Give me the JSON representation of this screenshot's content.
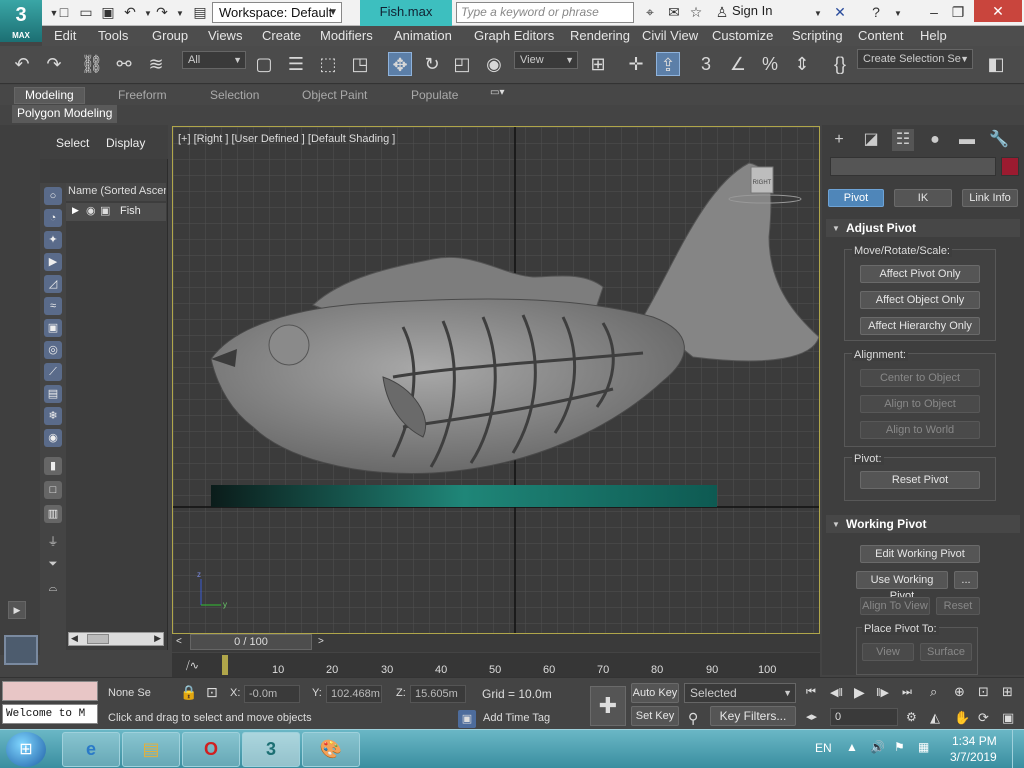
{
  "app": {
    "logo_main": "3",
    "logo_sub": "MAX",
    "workspace": "Workspace: Default",
    "file_tab": "Fish.max",
    "search_placeholder": "Type a keyword or phrase",
    "sign_in": "Sign In"
  },
  "menu": [
    "Edit",
    "Tools",
    "Group",
    "Views",
    "Create",
    "Modifiers",
    "Animation",
    "Graph Editors",
    "Rendering",
    "Civil View",
    "Customize",
    "Scripting",
    "Content",
    "Help"
  ],
  "toolbar": {
    "filter": "All",
    "ref_coord": "View",
    "selection_set": "Create Selection Se"
  },
  "ribbon": {
    "tabs": [
      "Modeling",
      "Freeform",
      "Selection",
      "Object Paint",
      "Populate"
    ],
    "panel": "Polygon Modeling"
  },
  "explorer": {
    "tab_select": "Select",
    "tab_display": "Display",
    "column": "Name (Sorted Ascer",
    "object": "Fish"
  },
  "viewport": {
    "label": "[+] [Right ] [User Defined ] [Default Shading ]",
    "viewcube": "RIGHT",
    "axis_y": "y",
    "axis_z": "z"
  },
  "command_panel": {
    "tabs": [
      "Pivot",
      "IK",
      "Link Info"
    ],
    "adjust_pivot": "Adjust Pivot",
    "move_rotate_scale": "Move/Rotate/Scale:",
    "affect_pivot_only": "Affect Pivot Only",
    "affect_object_only": "Affect Object Only",
    "affect_hierarchy_only": "Affect Hierarchy Only",
    "alignment": "Alignment:",
    "center_to_object": "Center to Object",
    "align_to_object": "Align to Object",
    "align_to_world": "Align to World",
    "pivot": "Pivot:",
    "reset_pivot": "Reset Pivot",
    "working_pivot": "Working Pivot",
    "edit_working_pivot": "Edit Working Pivot",
    "use_working_pivot": "Use Working Pivot",
    "dots": "...",
    "align_to_view": "Align To View",
    "reset": "Reset",
    "place_pivot_to": "Place Pivot To:",
    "view": "View",
    "surface": "Surface"
  },
  "timeline": {
    "frame": "0 / 100",
    "ticks": [
      "10",
      "20",
      "30",
      "40",
      "50",
      "60",
      "70",
      "80",
      "90",
      "100"
    ]
  },
  "status": {
    "listener": "Welcome to M",
    "none_selected": "None Se",
    "x_label": "X:",
    "x_val": "-0.0m",
    "y_label": "Y:",
    "y_val": "102.468m",
    "z_label": "Z:",
    "z_val": "15.605m",
    "grid": "Grid = 10.0m",
    "prompt": "Click and drag to select and move objects",
    "add_time_tag": "Add Time Tag",
    "auto_key": "Auto Key",
    "set_key": "Set Key",
    "selected": "Selected",
    "key_filters": "Key Filters...",
    "frame_input": "0"
  },
  "taskbar": {
    "lang": "EN",
    "time": "1:34 PM",
    "date": "3/7/2019"
  },
  "colors": {
    "accent": "#3dbfbf",
    "active_button": "#4f86b9",
    "viewport_border": "#b0a64a",
    "object_color": "#9b1b30"
  }
}
